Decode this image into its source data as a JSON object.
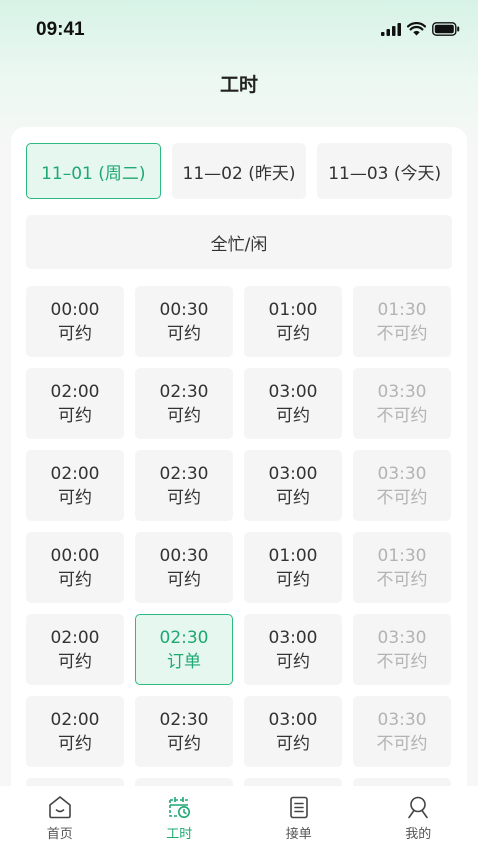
{
  "status_bar": {
    "time": "09:41"
  },
  "header": {
    "title": "工时"
  },
  "date_tabs": [
    {
      "label": "11–01 (周二)",
      "active": true
    },
    {
      "label": "11—02 (昨天)",
      "active": false
    },
    {
      "label": "11—03 (今天)",
      "active": false
    }
  ],
  "all_busy_label": "全忙/闲",
  "slots": [
    {
      "time": "00:00",
      "status": "可约",
      "state": "available"
    },
    {
      "time": "00:30",
      "status": "可约",
      "state": "available"
    },
    {
      "time": "01:00",
      "status": "可约",
      "state": "available"
    },
    {
      "time": "01:30",
      "status": "不可约",
      "state": "unavailable"
    },
    {
      "time": "02:00",
      "status": "可约",
      "state": "available"
    },
    {
      "time": "02:30",
      "status": "可约",
      "state": "available"
    },
    {
      "time": "03:00",
      "status": "可约",
      "state": "available"
    },
    {
      "time": "03:30",
      "status": "不可约",
      "state": "unavailable"
    },
    {
      "time": "02:00",
      "status": "可约",
      "state": "available"
    },
    {
      "time": "02:30",
      "status": "可约",
      "state": "available"
    },
    {
      "time": "03:00",
      "status": "可约",
      "state": "available"
    },
    {
      "time": "03:30",
      "status": "不可约",
      "state": "unavailable"
    },
    {
      "time": "00:00",
      "status": "可约",
      "state": "available"
    },
    {
      "time": "00:30",
      "status": "可约",
      "state": "available"
    },
    {
      "time": "01:00",
      "status": "可约",
      "state": "available"
    },
    {
      "time": "01:30",
      "status": "不可约",
      "state": "unavailable"
    },
    {
      "time": "02:00",
      "status": "可约",
      "state": "available"
    },
    {
      "time": "02:30",
      "status": "订单",
      "state": "order"
    },
    {
      "time": "03:00",
      "status": "可约",
      "state": "available"
    },
    {
      "time": "03:30",
      "status": "不可约",
      "state": "unavailable"
    },
    {
      "time": "02:00",
      "status": "可约",
      "state": "available"
    },
    {
      "time": "02:30",
      "status": "可约",
      "state": "available"
    },
    {
      "time": "03:00",
      "status": "可约",
      "state": "available"
    },
    {
      "time": "03:30",
      "status": "不可约",
      "state": "unavailable"
    },
    {
      "time": "",
      "status": "",
      "state": "available"
    },
    {
      "time": "",
      "status": "",
      "state": "available"
    },
    {
      "time": "",
      "status": "",
      "state": "available"
    },
    {
      "time": "",
      "status": "",
      "state": "available"
    }
  ],
  "tabbar": {
    "items": [
      {
        "label": "首页",
        "icon": "home-icon",
        "active": false
      },
      {
        "label": "工时",
        "icon": "calendar-clock-icon",
        "active": true
      },
      {
        "label": "接单",
        "icon": "clipboard-icon",
        "active": false
      },
      {
        "label": "我的",
        "icon": "user-icon",
        "active": false
      }
    ]
  },
  "colors": {
    "accent": "#1ea872",
    "accent_border": "#2bb980",
    "accent_bg": "#e6f7ef",
    "muted": "#b3b3b3"
  }
}
